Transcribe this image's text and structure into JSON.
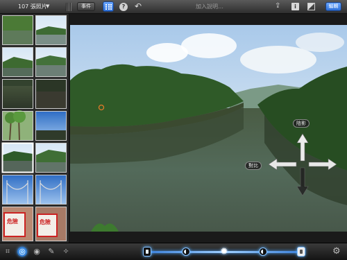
{
  "topbar": {
    "album_title": "107 張照片",
    "events_label": "事件",
    "caption_placeholder": "加入說明…",
    "edit_label": "編輯"
  },
  "overlay": {
    "up_label": "陰影",
    "left_label": "對比"
  },
  "icons": {
    "grid": "grid-icon",
    "help": "help-icon",
    "undo": "undo-icon",
    "share": "share-icon",
    "info": "info-icon",
    "compare": "compare-icon",
    "settings": "gear-icon"
  },
  "accent_color": "#3a8ef0",
  "sidebar": {
    "thumbnails": [
      {
        "label": "river-trees"
      },
      {
        "label": "river-bank"
      },
      {
        "label": "river-hills"
      },
      {
        "label": "river-wide"
      },
      {
        "label": "river-shadow"
      },
      {
        "label": "river-dark"
      },
      {
        "label": "palm-trees"
      },
      {
        "label": "bridge-sky"
      },
      {
        "label": "river-selected"
      },
      {
        "label": "river-hills-2"
      },
      {
        "label": "suspension-bridge"
      },
      {
        "label": "suspension-bridge-2"
      },
      {
        "label": "sign-red"
      },
      {
        "label": "sign-red-2"
      }
    ],
    "sign_text": "危險"
  }
}
